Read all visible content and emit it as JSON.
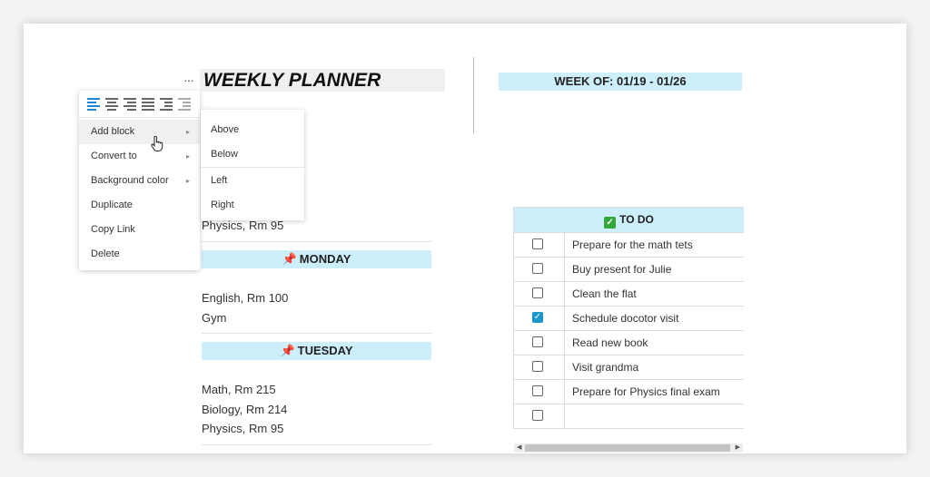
{
  "planner": {
    "more_label": "···",
    "title": "WEEKLY PLANNER",
    "week_of": "WEEK OF: 01/19 - 01/26",
    "partial_entry": "Physics, Rm 95",
    "monday": {
      "label": "MONDAY",
      "entries": [
        "English, Rm 100",
        "Gym"
      ]
    },
    "tuesday": {
      "label": "TUESDAY",
      "entries": [
        "Math, Rm 215",
        "Biology, Rm 214",
        "Physics, Rm 95"
      ]
    }
  },
  "context_menu": {
    "align_icons": [
      "align-left-icon",
      "align-center-icon",
      "align-right-icon",
      "align-justify-icon",
      "indent-icon",
      "outdent-icon"
    ],
    "items": [
      {
        "label": "Add block",
        "has_submenu": true
      },
      {
        "label": "Convert to",
        "has_submenu": true
      },
      {
        "label": "Background color",
        "has_submenu": true
      },
      {
        "label": "Duplicate",
        "has_submenu": false
      },
      {
        "label": "Copy Link",
        "has_submenu": false
      },
      {
        "label": "Delete",
        "has_submenu": false
      }
    ],
    "arrow_glyph": "▸"
  },
  "submenu": {
    "items": [
      "Above",
      "Below",
      "Left",
      "Right"
    ]
  },
  "todo": {
    "header": "TO DO",
    "header_emoji": "✓",
    "rows": [
      {
        "text": "Prepare for the math tets",
        "checked": false
      },
      {
        "text": "Buy present for Julie",
        "checked": false
      },
      {
        "text": "Clean the flat",
        "checked": false
      },
      {
        "text": "Schedule docotor visit",
        "checked": true
      },
      {
        "text": "Read new book",
        "checked": false
      },
      {
        "text": "Visit grandma",
        "checked": false
      },
      {
        "text": "Prepare for Physics final exam",
        "checked": false
      },
      {
        "text": "",
        "checked": false
      }
    ]
  },
  "colors": {
    "header_bg": "#cdeefb",
    "accent": "#1a96c8",
    "pin": "#d0332b"
  }
}
